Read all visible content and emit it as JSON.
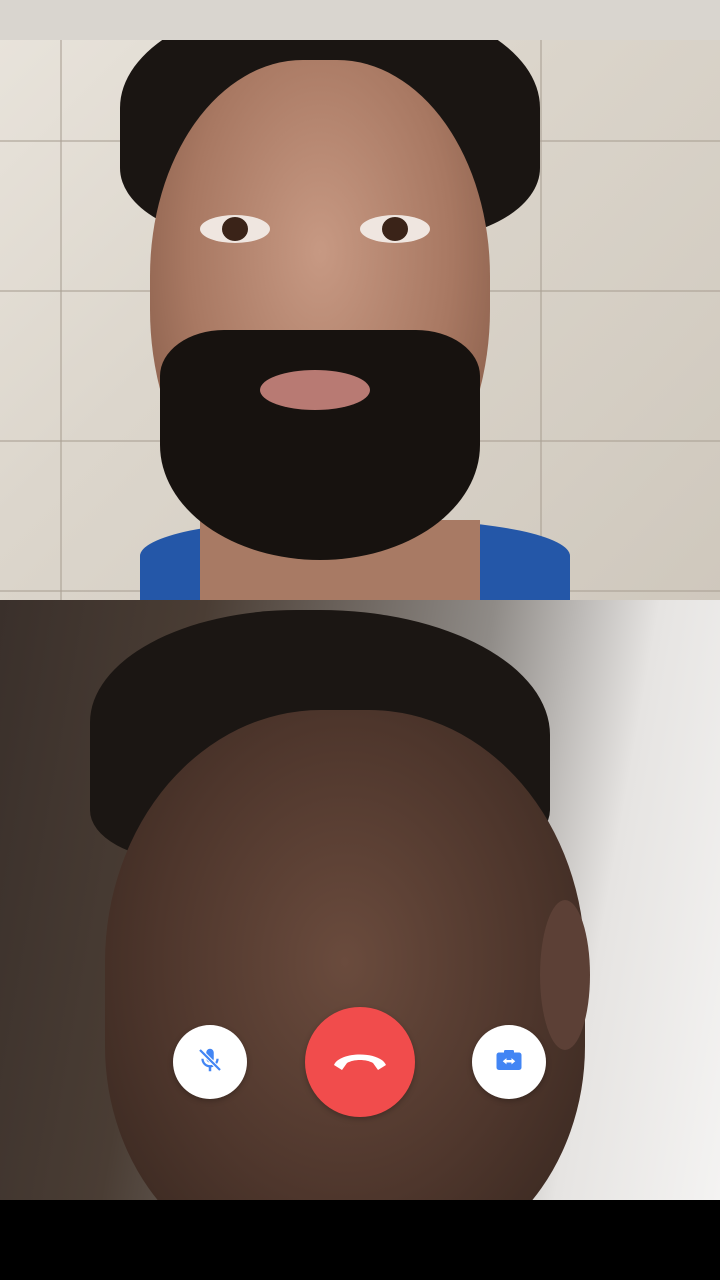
{
  "call": {
    "remote_participant": "remote-video",
    "local_participant": "local-video"
  },
  "controls": {
    "mute_icon": "mic-off-icon",
    "end_call_icon": "phone-hangup-icon",
    "switch_camera_icon": "camera-switch-icon"
  },
  "colors": {
    "end_call": "#f14c4c",
    "icon_accent": "#4285f4",
    "button_bg": "#ffffff"
  }
}
